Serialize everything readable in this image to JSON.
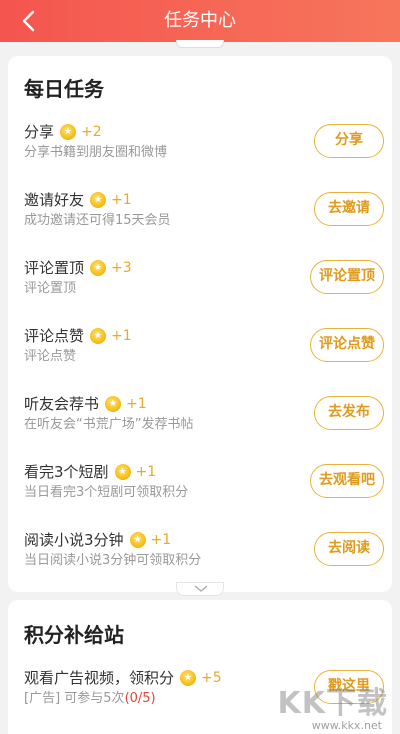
{
  "header": {
    "title": "任务中心"
  },
  "daily": {
    "title": "每日任务",
    "tasks": [
      {
        "name": "分享",
        "points": "+2",
        "desc": "分享书籍到朋友圈和微博",
        "button": "分享"
      },
      {
        "name": "邀请好友",
        "points": "+1",
        "desc": "成功邀请还可得15天会员",
        "button": "去邀请"
      },
      {
        "name": "评论置顶",
        "points": "+3",
        "desc": "评论置顶",
        "button": "评论置顶"
      },
      {
        "name": "评论点赞",
        "points": "+1",
        "desc": "评论点赞",
        "button": "评论点赞"
      },
      {
        "name": "听友会荐书",
        "points": "+1",
        "desc": "在听友会“书荒广场”发荐书帖",
        "button": "去发布"
      },
      {
        "name": "看完3个短剧",
        "points": "+1",
        "desc": "当日看完3个短剧可领取积分",
        "button": "去观看吧"
      },
      {
        "name": "阅读小说3分钟",
        "points": "+1",
        "desc": "当日阅读小说3分钟可领取积分",
        "button": "去阅读"
      }
    ]
  },
  "supply": {
    "title": "积分补给站",
    "task": {
      "name": "观看广告视频，领积分",
      "points": "+5",
      "desc_prefix": "[广告] 可参与5次",
      "desc_count": "(0/5)",
      "button": "戳这里"
    }
  },
  "watermark": {
    "text": "KK下载",
    "url": "www.kkx.net"
  },
  "colors": {
    "header_start": "#f4554f",
    "header_end": "#f7765b",
    "accent": "#e9b23a",
    "count": "#e0453b"
  }
}
